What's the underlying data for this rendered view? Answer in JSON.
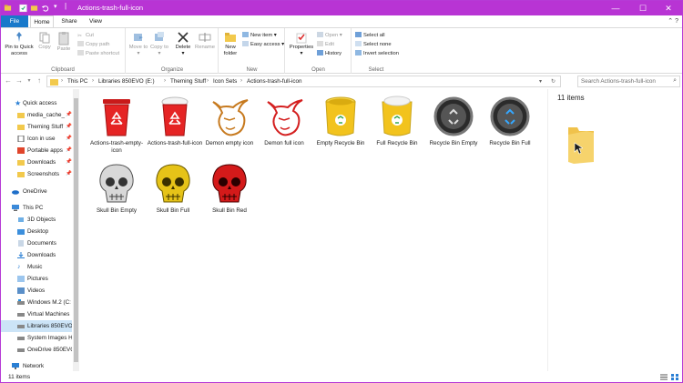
{
  "window": {
    "title": "Actions-trash-full-icon",
    "accent_color": "#b834d4",
    "controls": {
      "minimize": "—",
      "maximize": "☐",
      "close": "✕"
    }
  },
  "ribbon_tabs": {
    "file": "File",
    "home": "Home",
    "share": "Share",
    "view": "View"
  },
  "ribbon": {
    "clipboard": {
      "label": "Clipboard",
      "pin": "Pin to Quick access",
      "copy": "Copy",
      "paste": "Paste",
      "cut": "Cut",
      "copy_path": "Copy path",
      "paste_shortcut": "Paste shortcut"
    },
    "organize": {
      "label": "Organize",
      "move_to": "Move to",
      "copy_to": "Copy to",
      "delete": "Delete",
      "rename": "Rename"
    },
    "new": {
      "label": "New",
      "new_folder": "New folder",
      "new_item": "New item",
      "easy_access": "Easy access"
    },
    "open": {
      "label": "Open",
      "properties": "Properties",
      "open": "Open",
      "edit": "Edit",
      "history": "History"
    },
    "select": {
      "label": "Select",
      "select_all": "Select all",
      "select_none": "Select none",
      "invert": "Invert selection"
    }
  },
  "address": {
    "breadcrumbs": [
      "This PC",
      "Libraries 850EVO (E:)",
      "Theming Stuff",
      "Icon Sets",
      "Actions-trash-full-icon"
    ],
    "search_placeholder": "Search Actions-trash-full-icon"
  },
  "nav": {
    "quick_access": "Quick access",
    "items": [
      {
        "label": "media_cache_",
        "pinned": true
      },
      {
        "label": "Theming Stuff",
        "pinned": true
      },
      {
        "label": "Icon in use",
        "pinned": true
      },
      {
        "label": "Portable apps",
        "pinned": true
      },
      {
        "label": "Downloads",
        "pinned": true
      },
      {
        "label": "Screenshots",
        "pinned": true
      }
    ],
    "onedrive": "OneDrive",
    "this_pc": "This PC",
    "pc_items": [
      "3D Objects",
      "Desktop",
      "Documents",
      "Downloads",
      "Music",
      "Pictures",
      "Videos",
      "Windows M.2 (C:",
      "Virtual Machines",
      "Libraries 850EVO",
      "System Images H",
      "OneDrive 850EVC"
    ],
    "network": "Network",
    "pin_glyph": "📌"
  },
  "files": [
    {
      "name": "Actions-trash-empty-icon",
      "icon": "red-trash-empty-icon"
    },
    {
      "name": "Actions-trash-full-icon",
      "icon": "red-trash-full-icon"
    },
    {
      "name": "Demon empty icon",
      "icon": "demon-empty-icon"
    },
    {
      "name": "Demon full icon",
      "icon": "demon-full-icon"
    },
    {
      "name": "Empty Recycle Bin",
      "icon": "yellow-bin-empty-icon"
    },
    {
      "name": "Full Recycle Bin",
      "icon": "yellow-bin-full-icon"
    },
    {
      "name": "Recycle Bin Empty",
      "icon": "chrome-bin-empty-icon"
    },
    {
      "name": "Recycle Bin Full",
      "icon": "chrome-bin-full-icon"
    },
    {
      "name": "Skull Bin Empty",
      "icon": "skull-silver-icon"
    },
    {
      "name": "Skull Bin Full",
      "icon": "skull-gold-icon"
    },
    {
      "name": "Skull Bin Red",
      "icon": "skull-red-icon"
    }
  ],
  "preview": {
    "count": "11 items"
  },
  "status": {
    "count": "11 items"
  }
}
